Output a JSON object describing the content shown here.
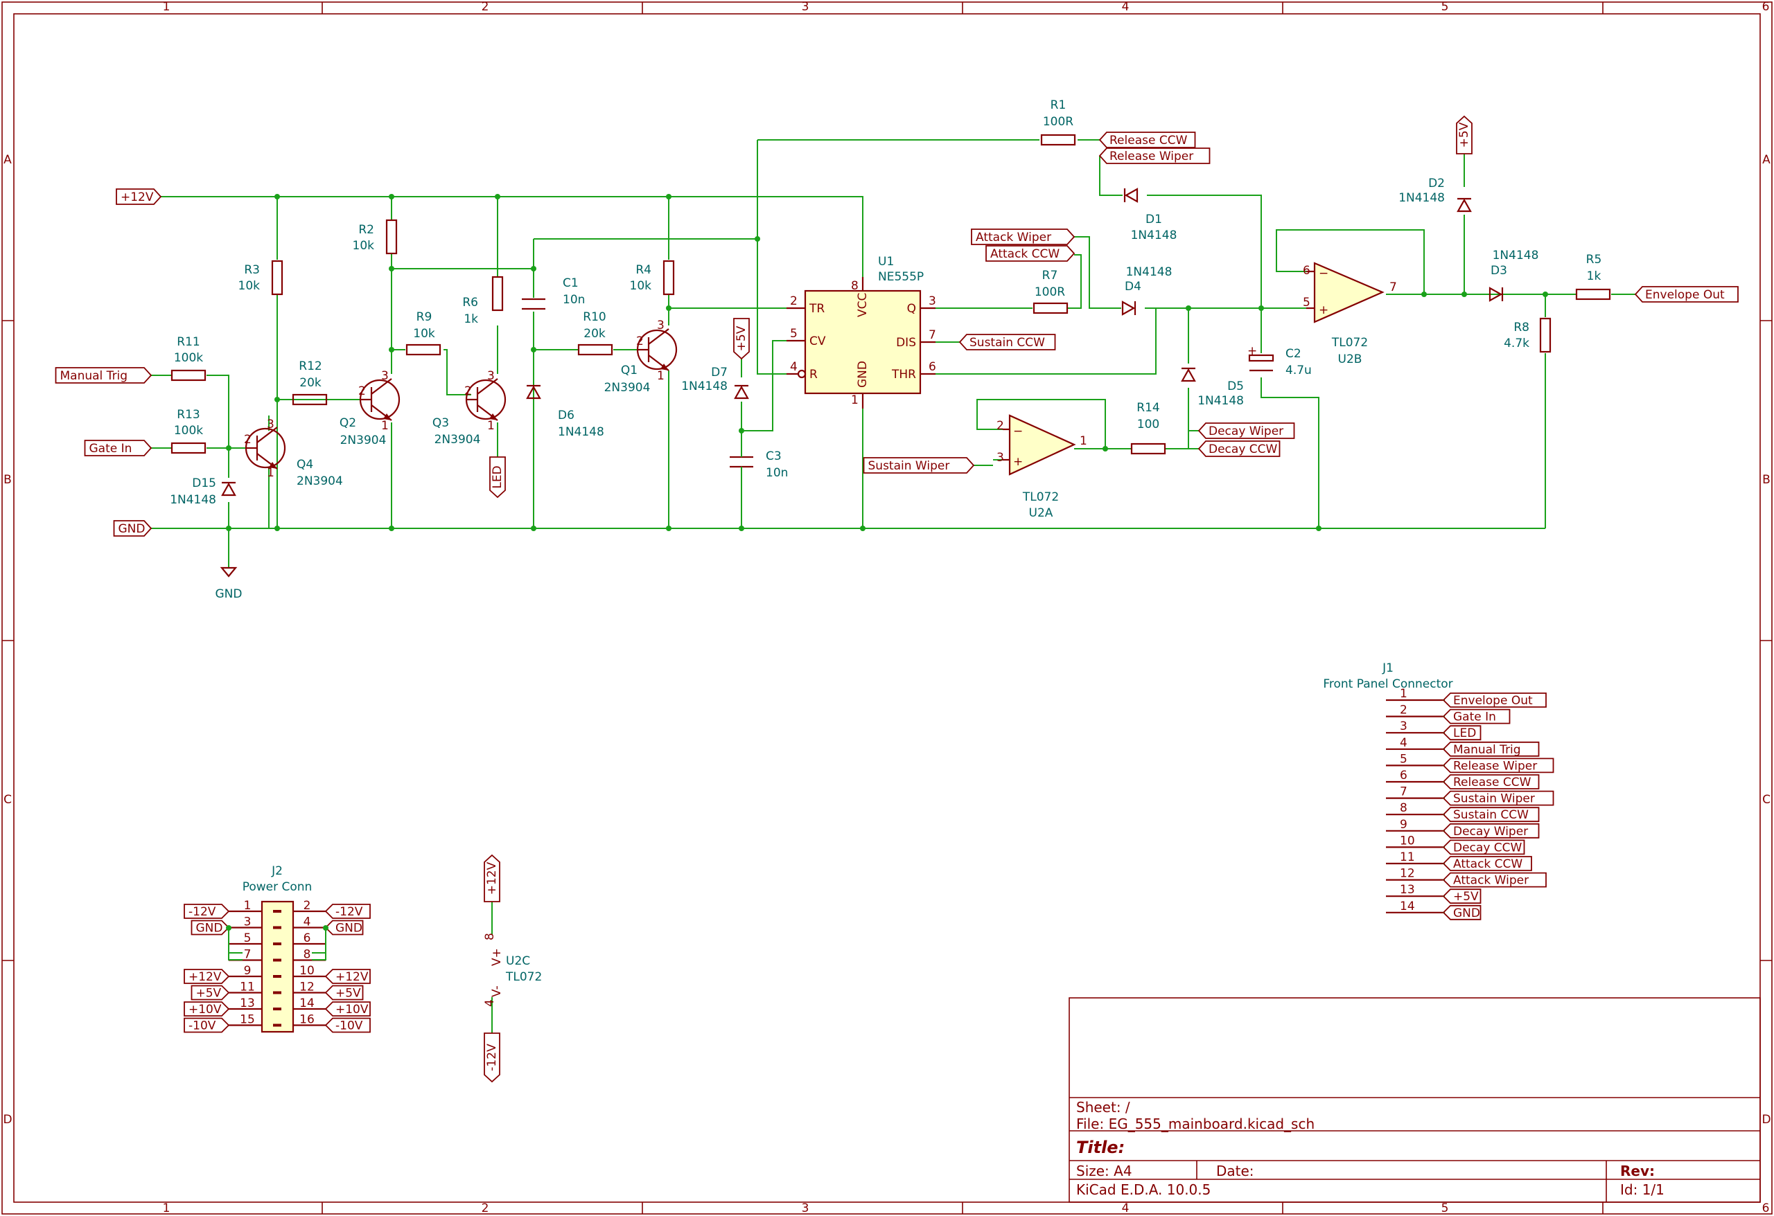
{
  "border": {
    "columns": [
      "1",
      "2",
      "3",
      "4",
      "5",
      "6"
    ],
    "rows": [
      "A",
      "B",
      "C",
      "D"
    ]
  },
  "labels": {
    "plus12": "+12V",
    "gnd": "GND",
    "manual_trig": "Manual Trig",
    "gate_in": "Gate In",
    "led": "LED",
    "plus5": "+5V",
    "release_ccw": "Release CCW",
    "release_wiper": "Release Wiper",
    "attack_wiper": "Attack Wiper",
    "attack_ccw": "Attack CCW",
    "sustain_ccw": "Sustain CCW",
    "sustain_wiper": "Sustain Wiper",
    "decay_wiper": "Decay Wiper",
    "decay_ccw": "Decay CCW",
    "envelope_out": "Envelope Out",
    "minus12": "-12V",
    "plus10": "+10V",
    "minus10": "-10V",
    "gnd_symbol": "GND"
  },
  "components": {
    "R1": {
      "ref": "R1",
      "val": "100R"
    },
    "R2": {
      "ref": "R2",
      "val": "10k"
    },
    "R3": {
      "ref": "R3",
      "val": "10k"
    },
    "R4": {
      "ref": "R4",
      "val": "10k"
    },
    "R5": {
      "ref": "R5",
      "val": "1k"
    },
    "R6": {
      "ref": "R6",
      "val": "1k"
    },
    "R7": {
      "ref": "R7",
      "val": "100R"
    },
    "R8": {
      "ref": "R8",
      "val": "4.7k"
    },
    "R9": {
      "ref": "R9",
      "val": "10k"
    },
    "R10": {
      "ref": "R10",
      "val": "20k"
    },
    "R11": {
      "ref": "R11",
      "val": "100k"
    },
    "R12": {
      "ref": "R12",
      "val": "20k"
    },
    "R13": {
      "ref": "R13",
      "val": "100k"
    },
    "R14": {
      "ref": "R14",
      "val": "100"
    },
    "C1": {
      "ref": "C1",
      "val": "10n"
    },
    "C2": {
      "ref": "C2",
      "val": "4.7u"
    },
    "C3": {
      "ref": "C3",
      "val": "10n"
    },
    "D1": {
      "ref": "D1",
      "val": "1N4148"
    },
    "D2": {
      "ref": "D2",
      "val": "1N4148"
    },
    "D3": {
      "ref": "D3",
      "val": "1N4148"
    },
    "D4": {
      "ref": "D4",
      "val": "1N4148"
    },
    "D5": {
      "ref": "D5",
      "val": "1N4148"
    },
    "D6": {
      "ref": "D6",
      "val": "1N4148"
    },
    "D7": {
      "ref": "D7",
      "val": "1N4148"
    },
    "D15": {
      "ref": "D15",
      "val": "1N4148"
    },
    "Q1": {
      "ref": "Q1",
      "val": "2N3904"
    },
    "Q2": {
      "ref": "Q2",
      "val": "2N3904"
    },
    "Q3": {
      "ref": "Q3",
      "val": "2N3904"
    },
    "Q4": {
      "ref": "Q4",
      "val": "2N3904"
    },
    "U1": {
      "ref": "U1",
      "val": "NE555P"
    },
    "U2A": {
      "ref": "U2A",
      "val": "TL072"
    },
    "U2B": {
      "ref": "U2B",
      "val": "TL072"
    },
    "U2C": {
      "ref": "U2C",
      "val": "TL072"
    },
    "J1": {
      "ref": "J1",
      "val": "Front Panel Connector"
    },
    "J2": {
      "ref": "J2",
      "val": "Power Conn"
    }
  },
  "ne555_pins": {
    "tr": "TR",
    "vcc": "VCC",
    "q": "Q",
    "cv": "CV",
    "dis": "DIS",
    "r": "R",
    "gnd": "GND",
    "thr": "THR",
    "n_tr": "2",
    "n_vcc": "8",
    "n_q": "3",
    "n_cv": "5",
    "n_dis": "7",
    "n_r": "4",
    "n_gnd": "1",
    "n_thr": "6"
  },
  "u2c_pins": {
    "vplus": "V+",
    "vminus": "V-",
    "n8": "8",
    "n4": "4"
  },
  "j1_pins": [
    {
      "num": "1",
      "label": "Envelope Out"
    },
    {
      "num": "2",
      "label": "Gate In"
    },
    {
      "num": "3",
      "label": "LED"
    },
    {
      "num": "4",
      "label": "Manual Trig"
    },
    {
      "num": "5",
      "label": "Release Wiper"
    },
    {
      "num": "6",
      "label": "Release CCW"
    },
    {
      "num": "7",
      "label": "Sustain Wiper"
    },
    {
      "num": "8",
      "label": "Sustain CCW"
    },
    {
      "num": "9",
      "label": "Decay Wiper"
    },
    {
      "num": "10",
      "label": "Decay CCW"
    },
    {
      "num": "11",
      "label": "Attack CCW"
    },
    {
      "num": "12",
      "label": "Attack Wiper"
    },
    {
      "num": "13",
      "label": "+5V"
    },
    {
      "num": "14",
      "label": "GND"
    }
  ],
  "j2_rows": [
    {
      "left_num": "1",
      "right_num": "2",
      "left_label": "-12V",
      "right_label": "-12V"
    },
    {
      "left_num": "3",
      "right_num": "4",
      "left_label": "GND",
      "right_label": "GND"
    },
    {
      "left_num": "5",
      "right_num": "6",
      "left_label": "",
      "right_label": ""
    },
    {
      "left_num": "7",
      "right_num": "8",
      "left_label": "",
      "right_label": ""
    },
    {
      "left_num": "9",
      "right_num": "10",
      "left_label": "+12V",
      "right_label": "+12V"
    },
    {
      "left_num": "11",
      "right_num": "12",
      "left_label": "+5V",
      "right_label": "+5V"
    },
    {
      "left_num": "13",
      "right_num": "14",
      "left_label": "+10V",
      "right_label": "+10V"
    },
    {
      "left_num": "15",
      "right_num": "16",
      "left_label": "-10V",
      "right_label": "-10V"
    }
  ],
  "title_block": {
    "sheet": "Sheet: /",
    "file": "File: EG_555_mainboard.kicad_sch",
    "title": "Title:",
    "size": "Size: A4",
    "date": "Date:",
    "rev": "Rev:",
    "kicad": "KiCad E.D.A. 10.0.5",
    "id": "Id: 1/1"
  }
}
